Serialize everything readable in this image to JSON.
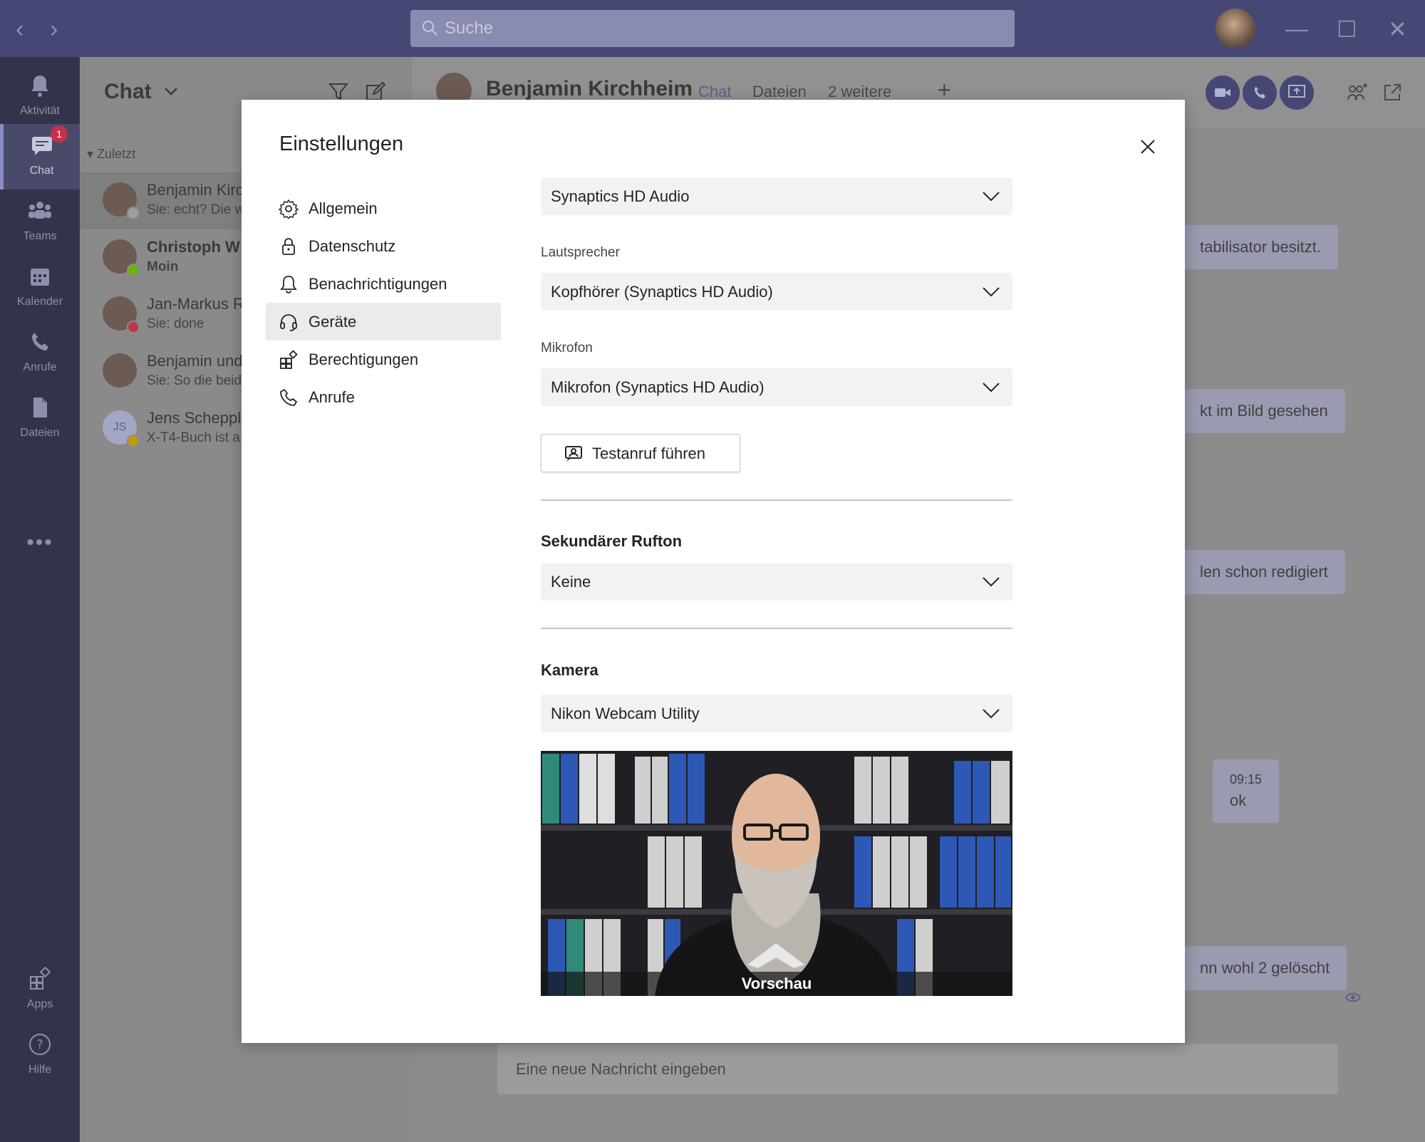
{
  "titlebar": {
    "back": "‹",
    "forward": "›",
    "search_placeholder": "Suche",
    "minimize": "—",
    "maximize": "☐",
    "close": "✕"
  },
  "rail": {
    "items": [
      {
        "label": "Aktivität",
        "icon": "bell-icon"
      },
      {
        "label": "Chat",
        "icon": "chat-icon",
        "badge": "1"
      },
      {
        "label": "Teams",
        "icon": "teams-icon"
      },
      {
        "label": "Kalender",
        "icon": "calendar-icon"
      },
      {
        "label": "Anrufe",
        "icon": "phone-icon"
      },
      {
        "label": "Dateien",
        "icon": "file-icon"
      }
    ],
    "more": "•••",
    "bottom": [
      {
        "label": "Apps",
        "icon": "apps-icon"
      },
      {
        "label": "Hilfe",
        "icon": "help-icon"
      }
    ]
  },
  "chatlist": {
    "title": "Chat",
    "recent_label": "Zuletzt",
    "items": [
      {
        "name": "Benjamin Kirc",
        "preview": "Sie: echt? Die w",
        "status": "#9e9e9e"
      },
      {
        "name": "Christoph W",
        "preview": "Moin",
        "status": "#6bb700"
      },
      {
        "name": "Jan-Markus R",
        "preview": "Sie: done",
        "status": "#c4314b"
      },
      {
        "name": "Benjamin und",
        "preview": "Sie: So die beid",
        "status": ""
      },
      {
        "name": "Jens Scheppl",
        "preview": "X-T4-Buch ist a",
        "status": "#c19c00",
        "initials": "JS"
      }
    ]
  },
  "conversation": {
    "name": "Benjamin Kirchheim",
    "tabs": [
      "Chat",
      "Dateien",
      "2 weitere"
    ],
    "add_tab": "+",
    "messages": [
      {
        "text": "tabilisator besitzt."
      },
      {
        "text": "kt im Bild gesehen"
      },
      {
        "text": "len schon redigiert"
      },
      {
        "time": "09:15",
        "text": "ok"
      },
      {
        "text": "nn wohl 2 gelöscht"
      }
    ],
    "compose_placeholder": "Eine neue Nachricht eingeben"
  },
  "modal": {
    "title": "Einstellungen",
    "nav": [
      {
        "label": "Allgemein",
        "icon": "gear-icon"
      },
      {
        "label": "Datenschutz",
        "icon": "lock-icon"
      },
      {
        "label": "Benachrichtigungen",
        "icon": "bell-icon"
      },
      {
        "label": "Geräte",
        "icon": "headset-icon",
        "active": true
      },
      {
        "label": "Berechtigungen",
        "icon": "permissions-icon"
      },
      {
        "label": "Anrufe",
        "icon": "phone-icon"
      }
    ],
    "audio_device": "Synaptics HD Audio",
    "speaker_label": "Lautsprecher",
    "speaker_value": "Kopfhörer (Synaptics HD Audio)",
    "mic_label": "Mikrofon",
    "mic_value": "Mikrofon (Synaptics HD Audio)",
    "test_call_label": "Testanruf führen",
    "secondary_ring_heading": "Sekundärer Rufton",
    "secondary_ring_value": "Keine",
    "camera_heading": "Kamera",
    "camera_value": "Nikon Webcam Utility",
    "preview_label": "Vorschau"
  }
}
